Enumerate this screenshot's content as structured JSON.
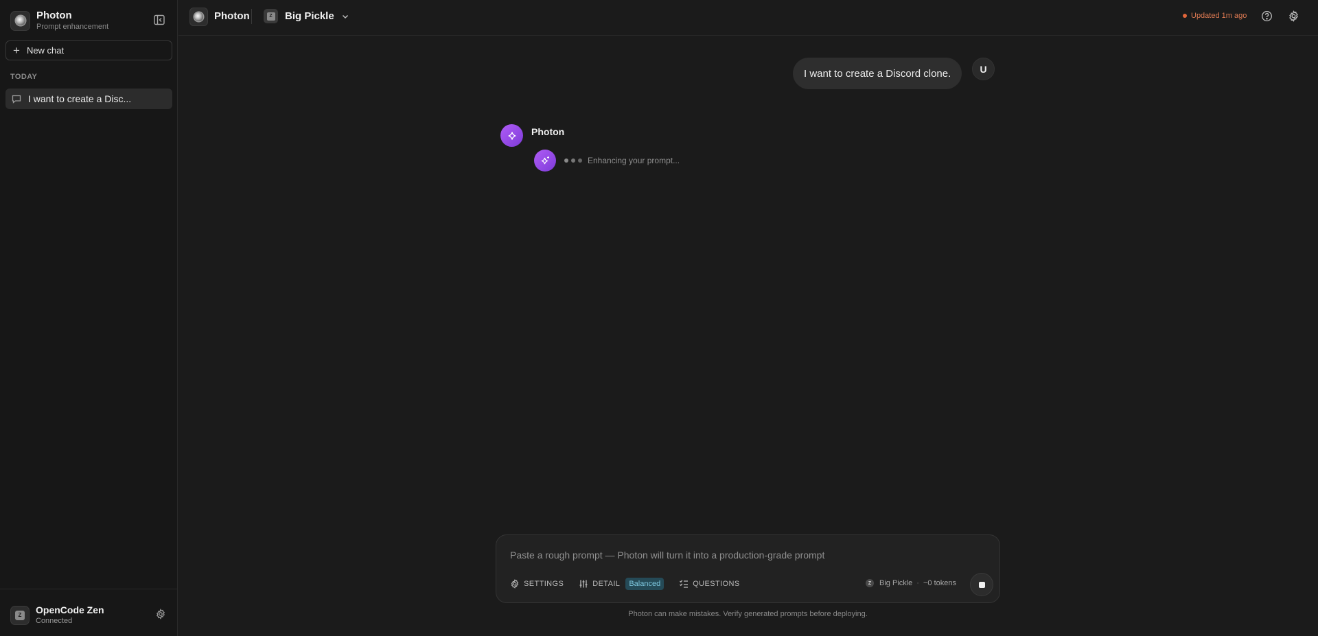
{
  "sidebar": {
    "app_name": "Photon",
    "app_subtitle": "Prompt enhancement",
    "new_chat_label": "New chat",
    "section_label": "TODAY",
    "history": [
      {
        "label": "I want to create a Disc..."
      }
    ],
    "footer": {
      "provider_name": "OpenCode Zen",
      "provider_status": "Connected",
      "provider_initial": "Z"
    }
  },
  "topbar": {
    "app_name": "Photon",
    "model_initial": "Z",
    "model_name": "Big Pickle",
    "update_status": "Updated 1m ago",
    "status_color": "#e0653a"
  },
  "chat": {
    "user_message": "I want to create a Discord clone.",
    "user_avatar_initial": "U",
    "assistant_name": "Photon",
    "assistant_status": "Enhancing your prompt..."
  },
  "composer": {
    "placeholder": "Paste a rough prompt — Photon will turn it into a production-grade prompt",
    "settings_label": "SETTINGS",
    "detail_label": "DETAIL",
    "detail_value": "Balanced",
    "questions_label": "QUESTIONS",
    "model_initial": "Z",
    "model_name": "Big Pickle",
    "token_count": "~0 tokens",
    "disclaimer": "Photon can make mistakes. Verify generated prompts before deploying."
  },
  "colors": {
    "accent_purple": "#9b4dea",
    "badge_bg": "#254a57",
    "badge_text": "#7ec8df"
  }
}
